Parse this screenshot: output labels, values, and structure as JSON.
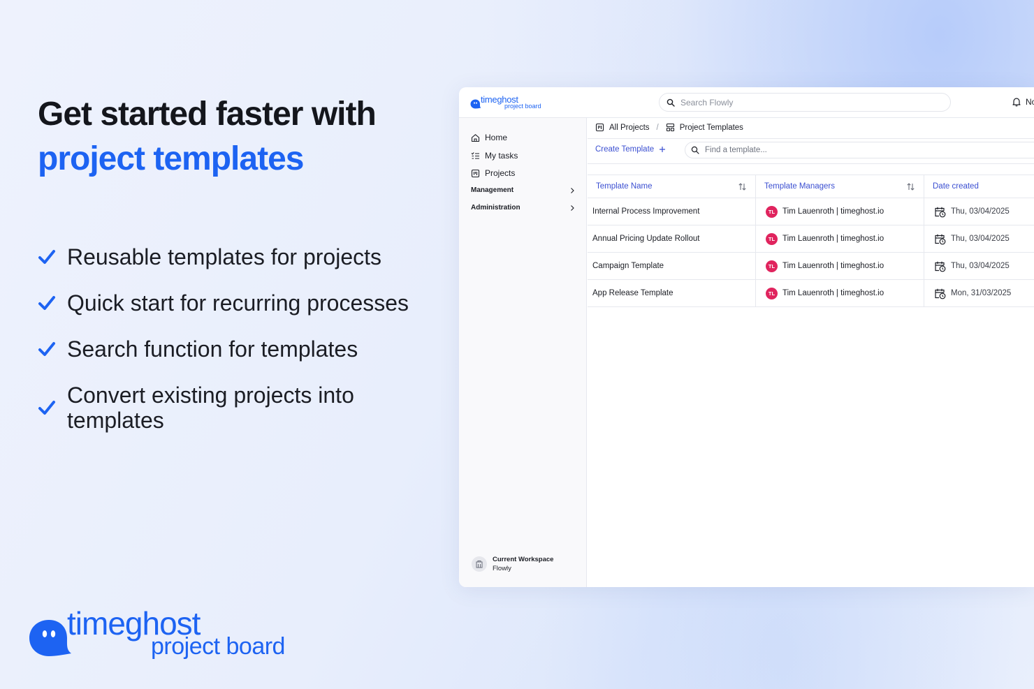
{
  "marketing": {
    "headline_line1": "Get started faster with",
    "headline_line2": "project templates",
    "features": [
      "Reusable templates for projects",
      "Quick start for recurring processes",
      "Search function for templates",
      "Convert existing projects into templates"
    ],
    "brand_name": "timeghost",
    "brand_product": "project board",
    "accent_color": "#1d63f2"
  },
  "app": {
    "logo_name": "timeghost",
    "logo_product": "project board",
    "search_placeholder": "Search Flowly",
    "notifications_label": "No",
    "sidebar": {
      "items": [
        {
          "label": "Home",
          "icon": "home-icon"
        },
        {
          "label": "My tasks",
          "icon": "tasks-icon"
        },
        {
          "label": "Projects",
          "icon": "projects-icon"
        }
      ],
      "groups": [
        {
          "label": "Management",
          "icon": "chevron-right-icon"
        },
        {
          "label": "Administration",
          "icon": "chevron-right-icon"
        }
      ],
      "workspace_title": "Current Workspace",
      "workspace_name": "Flowly"
    },
    "breadcrumb": {
      "root": "All Projects",
      "separator": "/",
      "current": "Project Templates"
    },
    "toolbar": {
      "create_label": "Create Template",
      "find_placeholder": "Find a template..."
    },
    "table": {
      "headers": [
        "Template Name",
        "Template Managers",
        "Date created"
      ],
      "rows": [
        {
          "name": "Internal Process Improvement",
          "initials": "TL",
          "manager": "Tim Lauenroth | timeghost.io",
          "date": "Thu, 03/04/2025"
        },
        {
          "name": "Annual Pricing Update Rollout",
          "initials": "TL",
          "manager": "Tim Lauenroth | timeghost.io",
          "date": "Thu, 03/04/2025"
        },
        {
          "name": "Campaign Template",
          "initials": "TL",
          "manager": "Tim Lauenroth | timeghost.io",
          "date": "Thu, 03/04/2025"
        },
        {
          "name": "App Release Template",
          "initials": "TL",
          "manager": "Tim Lauenroth | timeghost.io",
          "date": "Mon, 31/03/2025"
        }
      ]
    },
    "colors": {
      "link": "#3b4fd1",
      "avatar": "#e0245e"
    }
  }
}
